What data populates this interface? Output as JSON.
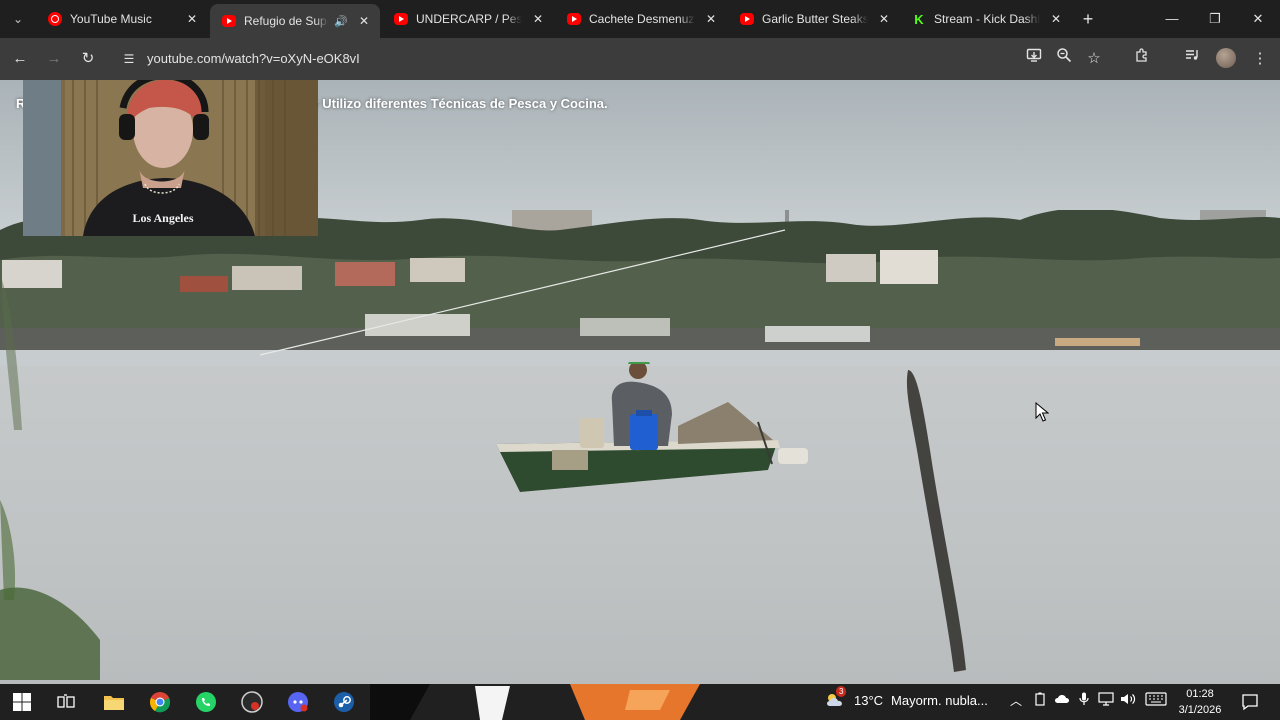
{
  "browser": {
    "tabs": [
      {
        "label": "YouTube Music",
        "favicon": "youtube-music-icon",
        "active": false
      },
      {
        "label": "Refugio de Supervivencia",
        "favicon": "youtube-icon",
        "active": true,
        "audio": true
      },
      {
        "label": "UNDERCARP / Pesca",
        "favicon": "youtube-icon",
        "active": false
      },
      {
        "label": "Cachete Desmenuzado",
        "favicon": "youtube-icon",
        "active": false
      },
      {
        "label": "Garlic Butter Steaks a",
        "favicon": "youtube-icon",
        "active": false
      },
      {
        "label": "Stream - Kick Dashboard",
        "favicon": "kick-icon",
        "active": false
      }
    ],
    "address": {
      "url": "youtube.com/watch?v=oXyN-eOK8vI"
    },
    "accent_color": "#ff0000",
    "kick_color": "#53fc18"
  },
  "video": {
    "caption": "y Utilizo diferentes Técnicas de Pesca y Cocina.",
    "caption_prefix": "R",
    "webcam_shirt_text": "Los Angeles"
  },
  "taskbar": {
    "weather": {
      "temp": "13°C",
      "desc": "Mayorm. nubla...",
      "alert_count": "3"
    },
    "clock": {
      "time": "01:28",
      "date": "3/1/2026"
    }
  }
}
